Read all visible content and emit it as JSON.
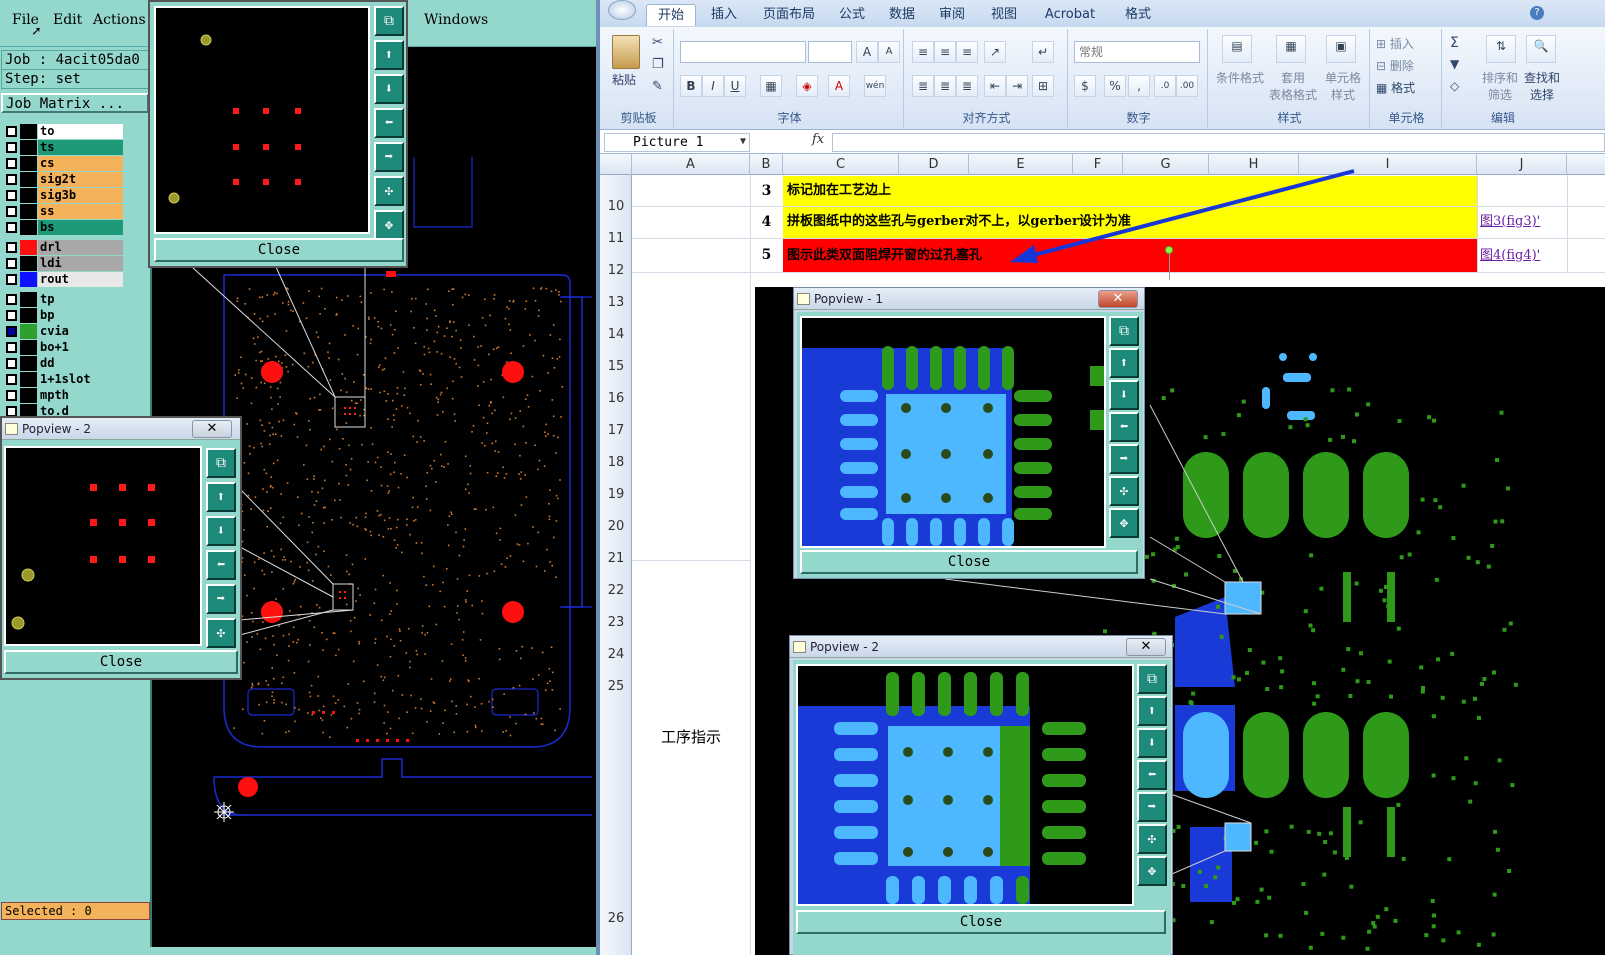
{
  "cam": {
    "menu": [
      "File",
      "Edit",
      "Actions",
      "Windows"
    ],
    "job": "Job : 4acit05da0",
    "step": "Step: set",
    "job_matrix": "Job Matrix ...",
    "layers": [
      {
        "name": "to",
        "color": "#ffffff",
        "sw": "#000000",
        "on": false
      },
      {
        "name": "ts",
        "color": "#1e9a78",
        "sw": "#000000",
        "on": false
      },
      {
        "name": "cs",
        "color": "#f4b35a",
        "sw": "#000000",
        "on": false
      },
      {
        "name": "sig2t",
        "color": "#f4b35a",
        "sw": "#000000",
        "on": false
      },
      {
        "name": "sig3b",
        "color": "#f4b35a",
        "sw": "#000000",
        "on": false
      },
      {
        "name": "ss",
        "color": "#f4b35a",
        "sw": "#000000",
        "on": false
      },
      {
        "name": "bs",
        "color": "#1e9a78",
        "sw": "#000000",
        "on": false
      },
      {
        "name": "drl",
        "color": "#a8a8a8",
        "sw": "#ff1010",
        "on": false
      },
      {
        "name": "ldi",
        "color": "#a8a8a8",
        "sw": "#000000",
        "on": false
      },
      {
        "name": "rout",
        "color": "#e8e8e8",
        "sw": "#1010ff",
        "on": false
      },
      {
        "name": "tp",
        "color": "#94d7cd",
        "sw": "#000000",
        "on": false
      },
      {
        "name": "bp",
        "color": "#94d7cd",
        "sw": "#000000",
        "on": false
      },
      {
        "name": "cvia",
        "color": "#94d7cd",
        "sw": "#2fa02f",
        "on": true
      },
      {
        "name": "bo+1",
        "color": "#94d7cd",
        "sw": "#000000",
        "on": false
      },
      {
        "name": "dd",
        "color": "#94d7cd",
        "sw": "#000000",
        "on": false
      },
      {
        "name": "1+1slot",
        "color": "#94d7cd",
        "sw": "#000000",
        "on": false
      },
      {
        "name": "mpth",
        "color": "#94d7cd",
        "sw": "#000000",
        "on": false
      },
      {
        "name": "to.d",
        "color": "#94d7cd",
        "sw": "#000000",
        "on": false
      }
    ],
    "selected": "Selected : 0",
    "popview_top_close": "Close",
    "popview2_title": "Popview - 2",
    "popview2_close": "Close"
  },
  "excel": {
    "tabs": [
      "开始",
      "插入",
      "页面布局",
      "公式",
      "数据",
      "审阅",
      "视图",
      "Acrobat",
      "格式"
    ],
    "groups": {
      "clipboard": "剪贴板",
      "font": "字体",
      "align": "对齐方式",
      "number": "数字",
      "styles": "样式",
      "cells": "单元格",
      "edit": "编辑"
    },
    "buttons": {
      "paste": "粘贴",
      "cond_format": "条件格式",
      "table_format": "套用\n表格格式",
      "cell_style": "单元格\n样式",
      "insert": "插入",
      "delete": "删除",
      "format": "格式",
      "sort": "排序和\n筛选",
      "find": "查找和\n选择",
      "number_format": "常规"
    },
    "name_box": "Picture 1",
    "fx": "fx",
    "columns": [
      "A",
      "B",
      "C",
      "D",
      "E",
      "F",
      "G",
      "H",
      "I",
      "J"
    ],
    "rows": [
      "10",
      "11",
      "12",
      "13",
      "14",
      "15",
      "16",
      "17",
      "18",
      "19",
      "20",
      "21",
      "22",
      "23",
      "24",
      "25",
      "26"
    ],
    "table": [
      {
        "num": "3",
        "text": "标记加在工艺边上",
        "link": ""
      },
      {
        "num": "4",
        "text": "拼板图纸中的这些孔与gerber对不上，以gerber设计为准",
        "link": "图3(fig3)'"
      },
      {
        "num": "5",
        "text": "图示此类双面阻焊开窗的过孔塞孔",
        "link": "图4(fig4)'"
      }
    ],
    "section_label": "工序指示",
    "colors": {
      "yellow": "#ffff00",
      "red": "#ff0000"
    }
  },
  "pic": {
    "popview1_title": "Popview - 1",
    "popview1_close": "Close",
    "popview2_title": "Popview - 2",
    "popview2_close": "Close"
  }
}
